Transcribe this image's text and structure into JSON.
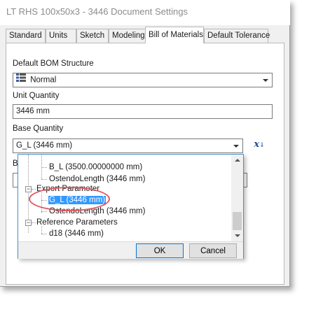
{
  "window": {
    "title": "LT RHS 100x50x3 - 3446 Document Settings"
  },
  "tabs": [
    {
      "label": "Standard"
    },
    {
      "label": "Units"
    },
    {
      "label": "Sketch"
    },
    {
      "label": "Modeling"
    },
    {
      "label": "Bill of Materials",
      "active": true
    },
    {
      "label": "Default Tolerance"
    }
  ],
  "bom": {
    "structure_label": "Default BOM Structure",
    "structure_value": "Normal",
    "unit_qty_label": "Unit Quantity",
    "unit_qty_value": "3446 mm",
    "base_qty_label": "Base Quantity",
    "base_qty_value": "G_L (3446 mm)",
    "hidden_label_fragment": "B",
    "fx_label": "x"
  },
  "dropdown": {
    "items": [
      {
        "text": "B_L (3500.00000000 mm)",
        "level": 2
      },
      {
        "text": "OstendoLength (3446 mm)",
        "level": 2
      },
      {
        "text": "Export Parameter",
        "level": 1,
        "expanded": true
      },
      {
        "text": "G_L (3446 mm)",
        "level": 2,
        "selected": true
      },
      {
        "text": "OstendoLength (3446 mm)",
        "level": 2
      },
      {
        "text": "Reference Parameters",
        "level": 1,
        "expanded": true
      },
      {
        "text": "d18 (3446 mm)",
        "level": 2
      }
    ],
    "ok_label": "OK",
    "cancel_label": "Cancel"
  },
  "colors": {
    "selection": "#3399ff",
    "annotation": "#e0575e",
    "accent": "#0078d7"
  },
  "icons": [
    "bom-structure-icon",
    "fx-parameter-icon",
    "chevron-down-icon",
    "tree-expand-icon"
  ]
}
